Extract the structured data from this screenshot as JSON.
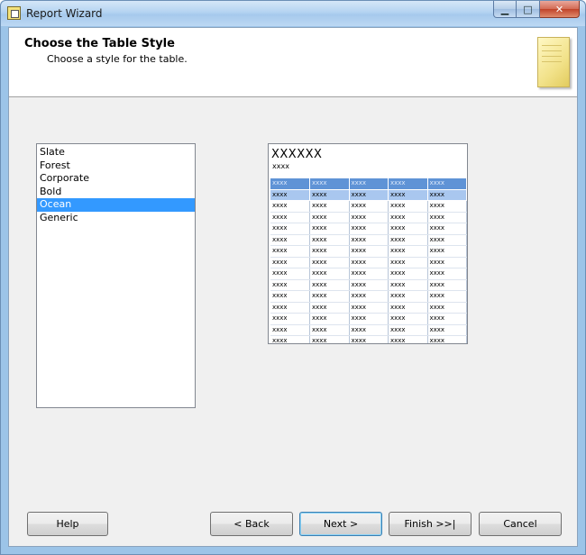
{
  "window": {
    "title": "Report Wizard",
    "controls": {
      "minimize": "▁",
      "maximize": "□",
      "close": "✕"
    }
  },
  "header": {
    "title": "Choose the Table Style",
    "subtitle": "Choose a style for the table.",
    "icon": "notepad-icon"
  },
  "styles": {
    "items": [
      "Slate",
      "Forest",
      "Corporate",
      "Bold",
      "Ocean",
      "Generic"
    ],
    "selected": "Ocean"
  },
  "preview": {
    "title": "XXXXXX",
    "subtitle": "xxxx",
    "cell": "xxxx",
    "columns": 5,
    "rows": 16,
    "colors": {
      "header": "#5f93d6",
      "selected_row": "#a9c7ef"
    }
  },
  "buttons": {
    "help": "Help",
    "back": "< Back",
    "next": "Next >",
    "finish": "Finish >>|",
    "cancel": "Cancel"
  }
}
